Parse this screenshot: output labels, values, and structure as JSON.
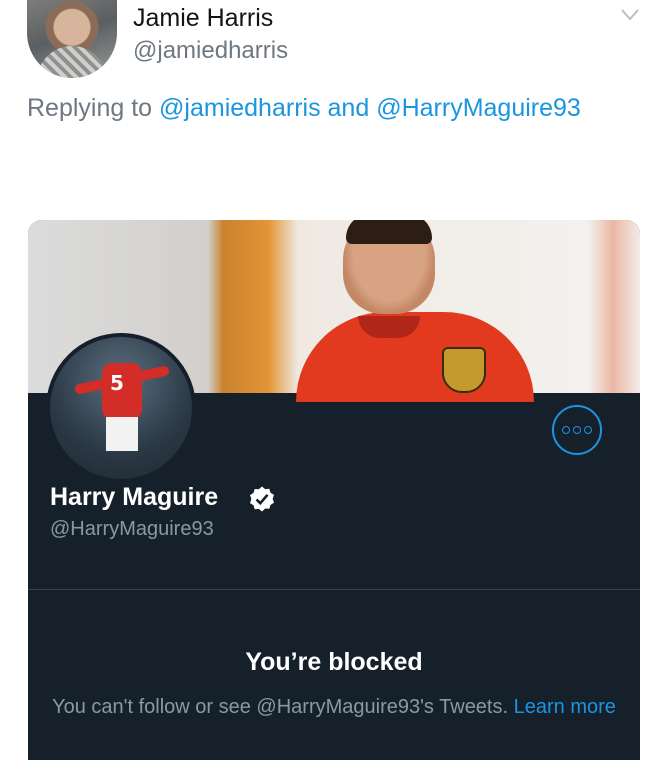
{
  "tweet": {
    "author_name": "Jamie Harris",
    "author_handle": "@jamiedharris",
    "replying_prefix": "Replying to",
    "reply_mention_1": "@jamiedharris",
    "reply_conjunction": "and",
    "reply_mention_2": "@HarryMaguire93",
    "menu_icon": "chevron-down-icon"
  },
  "profile_card": {
    "name": "Harry Maguire",
    "handle": "@HarryMaguire93",
    "verified_icon": "verified-badge-icon",
    "more_icon": "more-options-icon",
    "profile_number": "5",
    "blocked_title": "You’re blocked",
    "blocked_message": "You can't follow or see @HarryMaguire93's Tweets.",
    "learn_more": "Learn more"
  },
  "colors": {
    "accent": "#1b95e0",
    "card_background": "#15202b",
    "muted_text": "#8899a6",
    "jersey_red": "#e23a1f"
  }
}
